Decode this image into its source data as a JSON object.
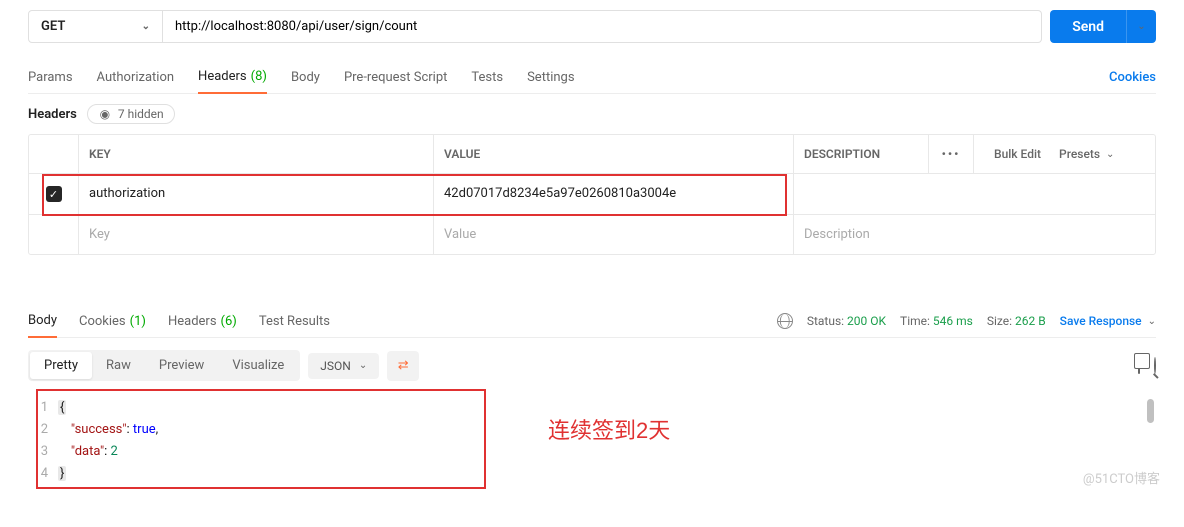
{
  "request": {
    "method": "GET",
    "url": "http://localhost:8080/api/user/sign/count",
    "send_label": "Send"
  },
  "tabs": {
    "params": "Params",
    "authorization": "Authorization",
    "headers": "Headers",
    "headers_count": "(8)",
    "body": "Body",
    "prerequest": "Pre-request Script",
    "tests": "Tests",
    "settings": "Settings",
    "cookies": "Cookies"
  },
  "sub": {
    "headers_label": "Headers",
    "hidden_label": "7 hidden"
  },
  "table": {
    "head_key": "KEY",
    "head_value": "VALUE",
    "head_desc": "DESCRIPTION",
    "bulk": "Bulk Edit",
    "presets": "Presets",
    "rows": [
      {
        "enabled": true,
        "key": "authorization",
        "value": "42d07017d8234e5a97e0260810a3004e",
        "description": ""
      }
    ],
    "ph_key": "Key",
    "ph_value": "Value",
    "ph_desc": "Description"
  },
  "response": {
    "tabs": {
      "body": "Body",
      "cookies": "Cookies",
      "cookies_count": "(1)",
      "headers": "Headers",
      "headers_count": "(6)",
      "tests": "Test Results"
    },
    "status_label": "Status:",
    "status_value": "200 OK",
    "time_label": "Time:",
    "time_value": "546 ms",
    "size_label": "Size:",
    "size_value": "262 B",
    "save_label": "Save Response",
    "viewmodes": {
      "pretty": "Pretty",
      "raw": "Raw",
      "preview": "Preview",
      "visualize": "Visualize"
    },
    "format": "JSON",
    "json_key1": "\"success\"",
    "json_val1": "true",
    "json_key2": "\"data\"",
    "json_val2": "2"
  },
  "annotation": "连续签到2天",
  "watermark": "@51CTO博客"
}
